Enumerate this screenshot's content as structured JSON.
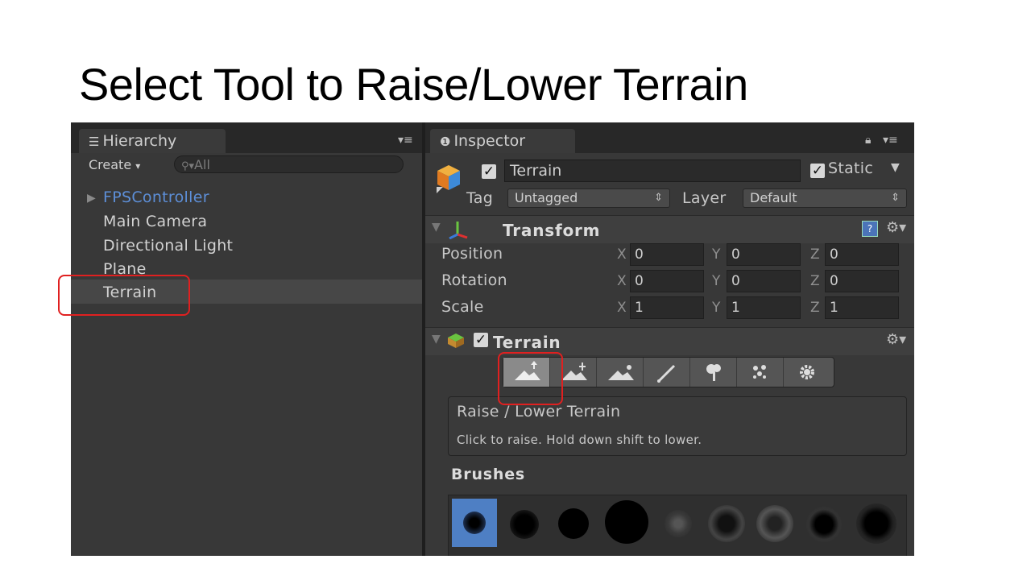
{
  "slide": {
    "title": "Select Tool to Raise/Lower Terrain"
  },
  "hierarchy": {
    "tab_label": "Hierarchy",
    "create_label": "Create",
    "search_placeholder": "All",
    "items": [
      {
        "label": "FPSController",
        "color": "#5d8fd8"
      },
      {
        "label": "Main Camera"
      },
      {
        "label": "Directional Light"
      },
      {
        "label": "Plane"
      },
      {
        "label": "Terrain",
        "selected": true
      }
    ]
  },
  "inspector": {
    "tab_label": "Inspector",
    "object_name": "Terrain",
    "static_label": "Static",
    "tag_label": "Tag",
    "tag_value": "Untagged",
    "layer_label": "Layer",
    "layer_value": "Default",
    "transform": {
      "title": "Transform",
      "rows": [
        {
          "label": "Position",
          "x": "0",
          "y": "0",
          "z": "0"
        },
        {
          "label": "Rotation",
          "x": "0",
          "y": "0",
          "z": "0"
        },
        {
          "label": "Scale",
          "x": "1",
          "y": "1",
          "z": "1"
        }
      ],
      "axis_labels": {
        "x": "X",
        "y": "Y",
        "z": "Z"
      }
    },
    "terrain": {
      "title": "Terrain",
      "tools": [
        "raise-lower",
        "paint-height",
        "smooth-height",
        "paint-texture",
        "place-trees",
        "paint-details",
        "settings"
      ],
      "active_tool": "raise-lower",
      "tool_name": "Raise / Lower Terrain",
      "tool_help": "Click to raise. Hold down shift to lower.",
      "brushes_label": "Brushes"
    }
  },
  "colors": {
    "highlight": "#e02020",
    "accent_blue": "#5d8fd8"
  }
}
